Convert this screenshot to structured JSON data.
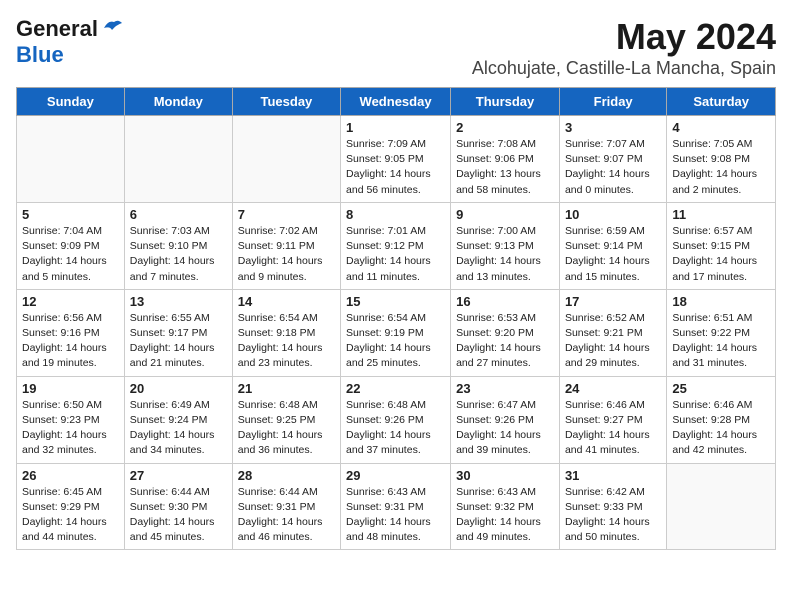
{
  "header": {
    "logo_line1": "General",
    "logo_line2": "Blue",
    "title": "May 2024",
    "subtitle": "Alcohujate, Castille-La Mancha, Spain"
  },
  "days_of_week": [
    "Sunday",
    "Monday",
    "Tuesday",
    "Wednesday",
    "Thursday",
    "Friday",
    "Saturday"
  ],
  "weeks": [
    [
      {
        "day": "",
        "info": ""
      },
      {
        "day": "",
        "info": ""
      },
      {
        "day": "",
        "info": ""
      },
      {
        "day": "1",
        "info": "Sunrise: 7:09 AM\nSunset: 9:05 PM\nDaylight: 14 hours and 56 minutes."
      },
      {
        "day": "2",
        "info": "Sunrise: 7:08 AM\nSunset: 9:06 PM\nDaylight: 13 hours and 58 minutes."
      },
      {
        "day": "3",
        "info": "Sunrise: 7:07 AM\nSunset: 9:07 PM\nDaylight: 14 hours and 0 minutes."
      },
      {
        "day": "4",
        "info": "Sunrise: 7:05 AM\nSunset: 9:08 PM\nDaylight: 14 hours and 2 minutes."
      }
    ],
    [
      {
        "day": "5",
        "info": "Sunrise: 7:04 AM\nSunset: 9:09 PM\nDaylight: 14 hours and 5 minutes."
      },
      {
        "day": "6",
        "info": "Sunrise: 7:03 AM\nSunset: 9:10 PM\nDaylight: 14 hours and 7 minutes."
      },
      {
        "day": "7",
        "info": "Sunrise: 7:02 AM\nSunset: 9:11 PM\nDaylight: 14 hours and 9 minutes."
      },
      {
        "day": "8",
        "info": "Sunrise: 7:01 AM\nSunset: 9:12 PM\nDaylight: 14 hours and 11 minutes."
      },
      {
        "day": "9",
        "info": "Sunrise: 7:00 AM\nSunset: 9:13 PM\nDaylight: 14 hours and 13 minutes."
      },
      {
        "day": "10",
        "info": "Sunrise: 6:59 AM\nSunset: 9:14 PM\nDaylight: 14 hours and 15 minutes."
      },
      {
        "day": "11",
        "info": "Sunrise: 6:57 AM\nSunset: 9:15 PM\nDaylight: 14 hours and 17 minutes."
      }
    ],
    [
      {
        "day": "12",
        "info": "Sunrise: 6:56 AM\nSunset: 9:16 PM\nDaylight: 14 hours and 19 minutes."
      },
      {
        "day": "13",
        "info": "Sunrise: 6:55 AM\nSunset: 9:17 PM\nDaylight: 14 hours and 21 minutes."
      },
      {
        "day": "14",
        "info": "Sunrise: 6:54 AM\nSunset: 9:18 PM\nDaylight: 14 hours and 23 minutes."
      },
      {
        "day": "15",
        "info": "Sunrise: 6:54 AM\nSunset: 9:19 PM\nDaylight: 14 hours and 25 minutes."
      },
      {
        "day": "16",
        "info": "Sunrise: 6:53 AM\nSunset: 9:20 PM\nDaylight: 14 hours and 27 minutes."
      },
      {
        "day": "17",
        "info": "Sunrise: 6:52 AM\nSunset: 9:21 PM\nDaylight: 14 hours and 29 minutes."
      },
      {
        "day": "18",
        "info": "Sunrise: 6:51 AM\nSunset: 9:22 PM\nDaylight: 14 hours and 31 minutes."
      }
    ],
    [
      {
        "day": "19",
        "info": "Sunrise: 6:50 AM\nSunset: 9:23 PM\nDaylight: 14 hours and 32 minutes."
      },
      {
        "day": "20",
        "info": "Sunrise: 6:49 AM\nSunset: 9:24 PM\nDaylight: 14 hours and 34 minutes."
      },
      {
        "day": "21",
        "info": "Sunrise: 6:48 AM\nSunset: 9:25 PM\nDaylight: 14 hours and 36 minutes."
      },
      {
        "day": "22",
        "info": "Sunrise: 6:48 AM\nSunset: 9:26 PM\nDaylight: 14 hours and 37 minutes."
      },
      {
        "day": "23",
        "info": "Sunrise: 6:47 AM\nSunset: 9:26 PM\nDaylight: 14 hours and 39 minutes."
      },
      {
        "day": "24",
        "info": "Sunrise: 6:46 AM\nSunset: 9:27 PM\nDaylight: 14 hours and 41 minutes."
      },
      {
        "day": "25",
        "info": "Sunrise: 6:46 AM\nSunset: 9:28 PM\nDaylight: 14 hours and 42 minutes."
      }
    ],
    [
      {
        "day": "26",
        "info": "Sunrise: 6:45 AM\nSunset: 9:29 PM\nDaylight: 14 hours and 44 minutes."
      },
      {
        "day": "27",
        "info": "Sunrise: 6:44 AM\nSunset: 9:30 PM\nDaylight: 14 hours and 45 minutes."
      },
      {
        "day": "28",
        "info": "Sunrise: 6:44 AM\nSunset: 9:31 PM\nDaylight: 14 hours and 46 minutes."
      },
      {
        "day": "29",
        "info": "Sunrise: 6:43 AM\nSunset: 9:31 PM\nDaylight: 14 hours and 48 minutes."
      },
      {
        "day": "30",
        "info": "Sunrise: 6:43 AM\nSunset: 9:32 PM\nDaylight: 14 hours and 49 minutes."
      },
      {
        "day": "31",
        "info": "Sunrise: 6:42 AM\nSunset: 9:33 PM\nDaylight: 14 hours and 50 minutes."
      },
      {
        "day": "",
        "info": ""
      }
    ]
  ]
}
